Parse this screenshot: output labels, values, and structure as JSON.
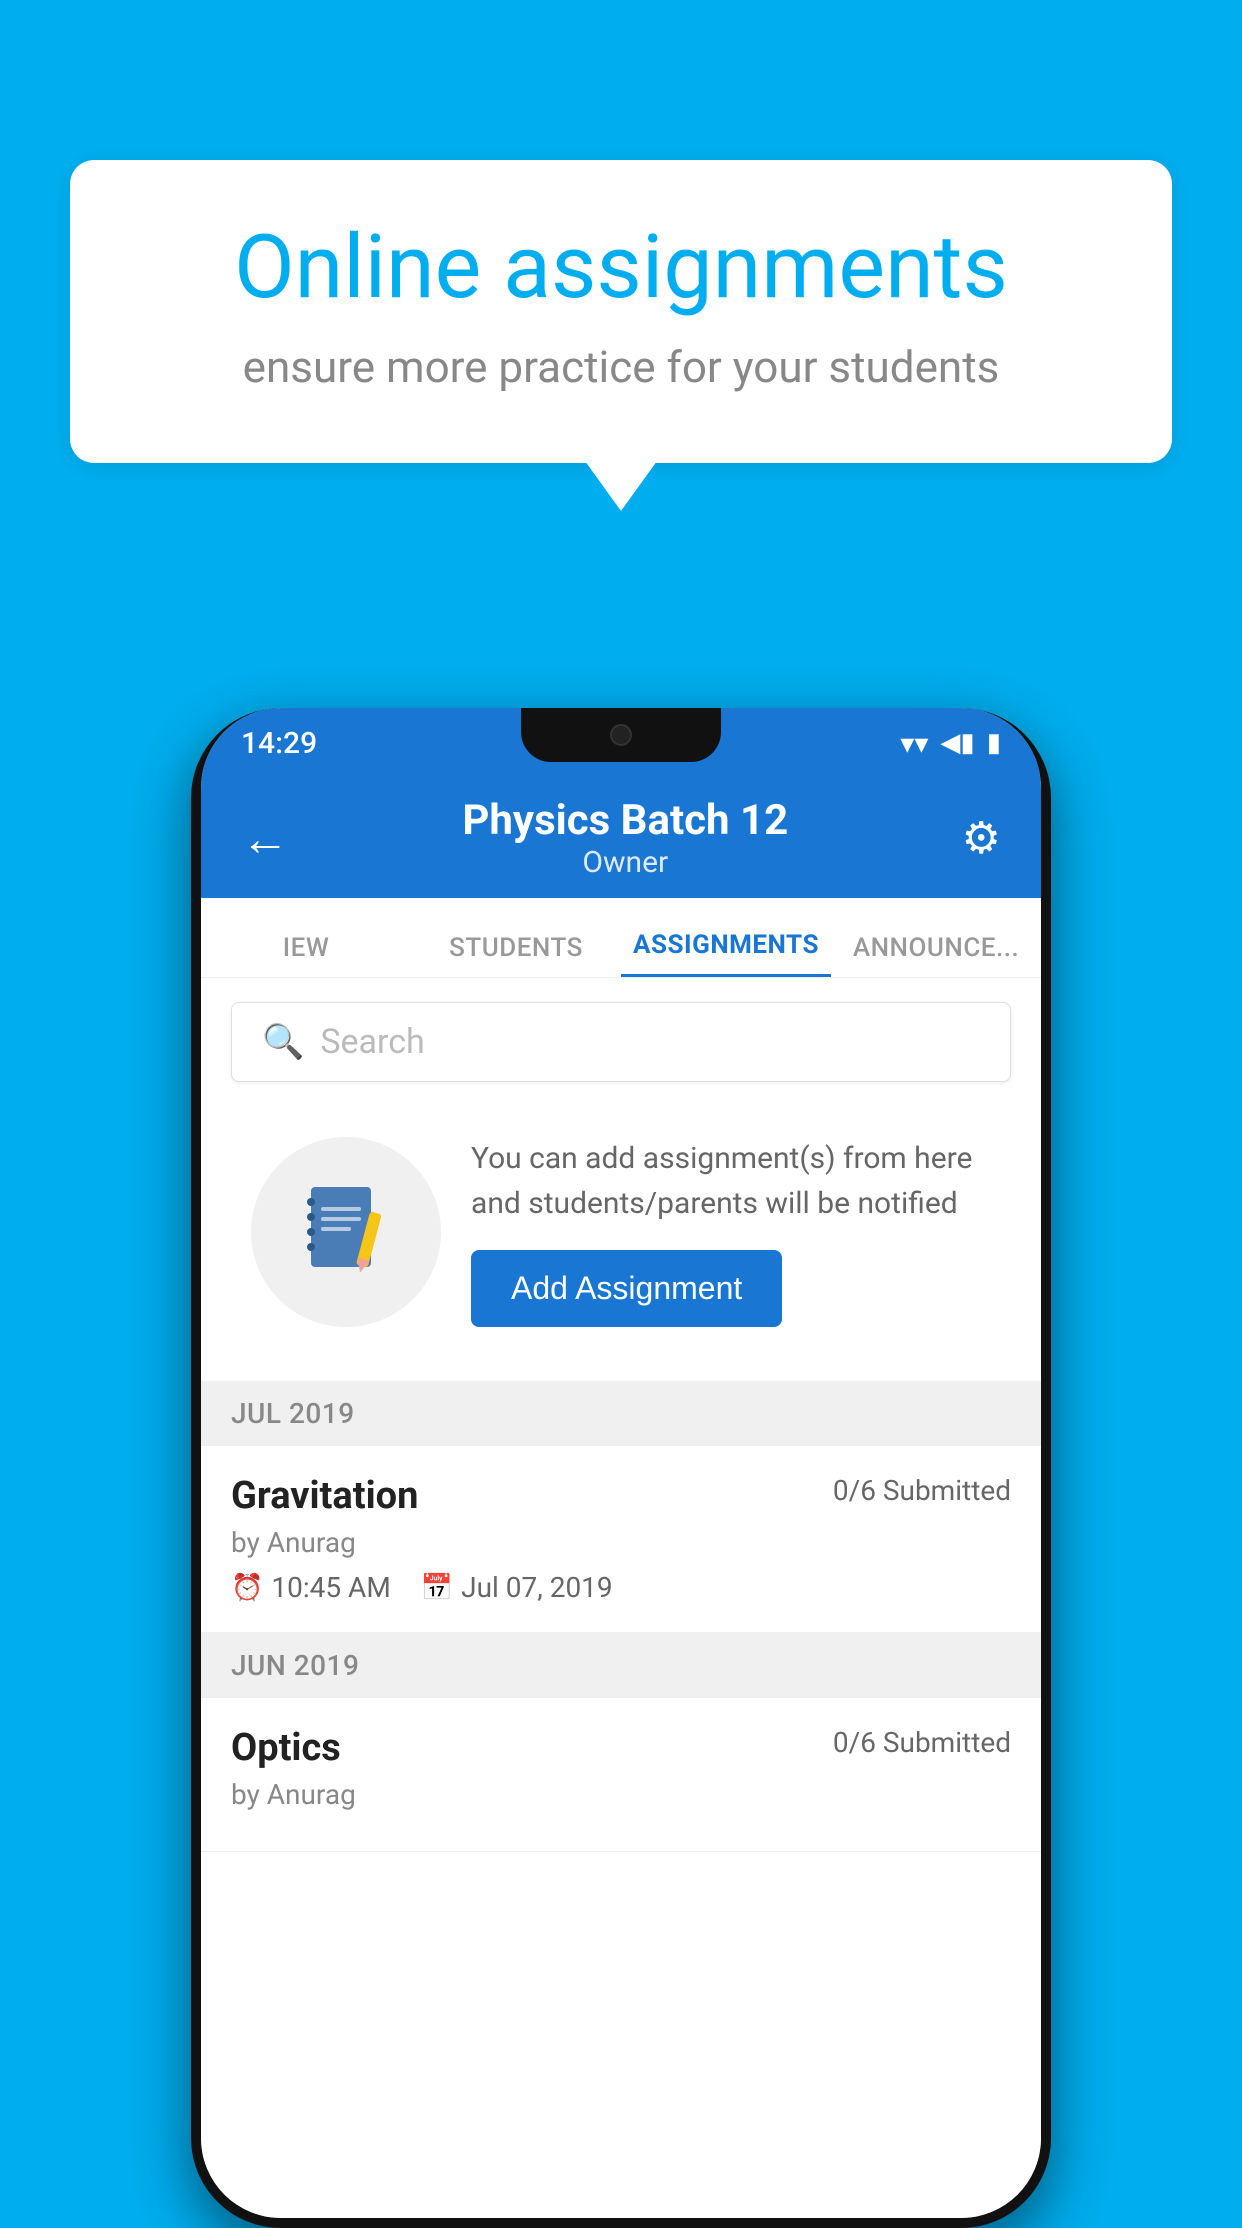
{
  "background_color": "#00AEEF",
  "speech_bubble": {
    "title": "Online assignments",
    "subtitle": "ensure more practice for your students"
  },
  "status_bar": {
    "time": "14:29",
    "wifi": "▲",
    "signal": "◀",
    "battery": "▮"
  },
  "header": {
    "title": "Physics Batch 12",
    "subtitle": "Owner",
    "back_label": "←",
    "settings_label": "⚙"
  },
  "tabs": [
    {
      "label": "IEW",
      "active": false
    },
    {
      "label": "STUDENTS",
      "active": false
    },
    {
      "label": "ASSIGNMENTS",
      "active": true
    },
    {
      "label": "ANNOUNCEMENTS",
      "active": false
    }
  ],
  "search": {
    "placeholder": "Search"
  },
  "empty_state": {
    "description": "You can add assignment(s) from here and students/parents will be notified",
    "button_label": "Add Assignment"
  },
  "sections": [
    {
      "label": "JUL 2019",
      "assignments": [
        {
          "title": "Gravitation",
          "submitted": "0/6 Submitted",
          "author": "by Anurag",
          "time": "10:45 AM",
          "date": "Jul 07, 2019"
        }
      ]
    },
    {
      "label": "JUN 2019",
      "assignments": [
        {
          "title": "Optics",
          "submitted": "0/6 Submitted",
          "author": "by Anurag",
          "time": "",
          "date": ""
        }
      ]
    }
  ]
}
